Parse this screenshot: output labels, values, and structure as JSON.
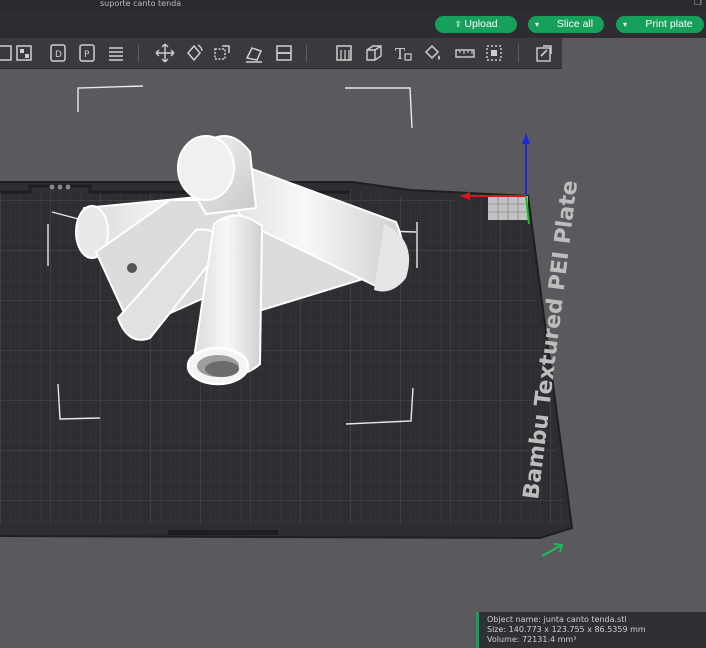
{
  "window": {
    "title": "suporte canto tenda"
  },
  "actions": {
    "upload_label": "Upload",
    "slice_label": "Slice all",
    "print_label": "Print plate",
    "accent_color": "#16a05a"
  },
  "toolbar": {
    "icons": [
      "add-plate-icon",
      "arrange-icon",
      "orient-icon",
      "split-icon",
      "move-icon",
      "rotate-icon",
      "scale-icon",
      "lay-on-face-icon",
      "cut-icon",
      "support-paint-icon",
      "seam-paint-icon",
      "text-icon",
      "color-paint-icon",
      "measure-icon",
      "assembly-icon",
      "search-icon"
    ]
  },
  "plate": {
    "label": "Bambu Textured PEI Plate"
  },
  "object_info": {
    "name_line": "Object name: junta canto tenda.stl",
    "size_line": "Size: 140.773 x 123.755 x 86.5359 mm",
    "volume_line": "Volume: 72131.4 mm³"
  }
}
